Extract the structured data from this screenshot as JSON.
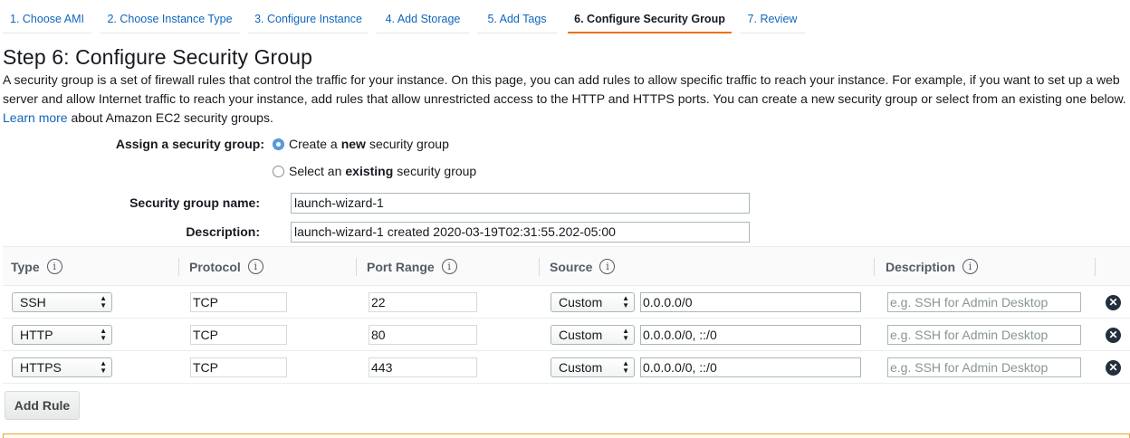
{
  "wizard": {
    "tabs": [
      {
        "label": "1. Choose AMI",
        "active": false
      },
      {
        "label": "2. Choose Instance Type",
        "active": false
      },
      {
        "label": "3. Configure Instance",
        "active": false
      },
      {
        "label": "4. Add Storage",
        "active": false
      },
      {
        "label": "5. Add Tags",
        "active": false
      },
      {
        "label": "6. Configure Security Group",
        "active": true
      },
      {
        "label": "7. Review",
        "active": false
      }
    ]
  },
  "page": {
    "title": "Step 6: Configure Security Group",
    "intro_text": "A security group is a set of firewall rules that control the traffic for your instance. On this page, you can add rules to allow specific traffic to reach your instance. For example, if you want to set up a web server and allow Internet traffic to reach your instance, add rules that allow unrestricted access to the HTTP and HTTPS ports. You can create a new security group or select from an existing one below.",
    "learn_more_label": "Learn more",
    "intro_suffix": "about Amazon EC2 security groups."
  },
  "assign": {
    "label": "Assign a security group:",
    "options": [
      {
        "prefix": "Create a ",
        "bold": "new",
        "suffix": " security group",
        "selected": true
      },
      {
        "prefix": "Select an ",
        "bold": "existing",
        "suffix": " security group",
        "selected": false
      }
    ]
  },
  "security_group": {
    "name_label": "Security group name:",
    "name_value": "launch-wizard-1",
    "description_label": "Description:",
    "description_value": "launch-wizard-1 created 2020-03-19T02:31:55.202-05:00"
  },
  "rules_table": {
    "columns": [
      "Type",
      "Protocol",
      "Port Range",
      "Source",
      "Description"
    ],
    "info_glyph": "i",
    "rows": [
      {
        "type": "SSH",
        "protocol": "TCP",
        "port_range": "22",
        "source_mode": "Custom",
        "source": "0.0.0.0/0",
        "description_placeholder": "e.g. SSH for Admin Desktop"
      },
      {
        "type": "HTTP",
        "protocol": "TCP",
        "port_range": "80",
        "source_mode": "Custom",
        "source": "0.0.0.0/0, ::/0",
        "description_placeholder": "e.g. SSH for Admin Desktop"
      },
      {
        "type": "HTTPS",
        "protocol": "TCP",
        "port_range": "443",
        "source_mode": "Custom",
        "source": "0.0.0.0/0, ::/0",
        "description_placeholder": "e.g. SSH for Admin Desktop"
      }
    ]
  },
  "add_rule_label": "Add Rule",
  "icons": {
    "select_arrows": "updown-arrows-icon",
    "remove": "close-circle-icon",
    "info": "info-icon"
  },
  "colors": {
    "link": "#1066bb",
    "active_tab_underline": "#ec7211",
    "warning_border": "#e8a33d"
  }
}
